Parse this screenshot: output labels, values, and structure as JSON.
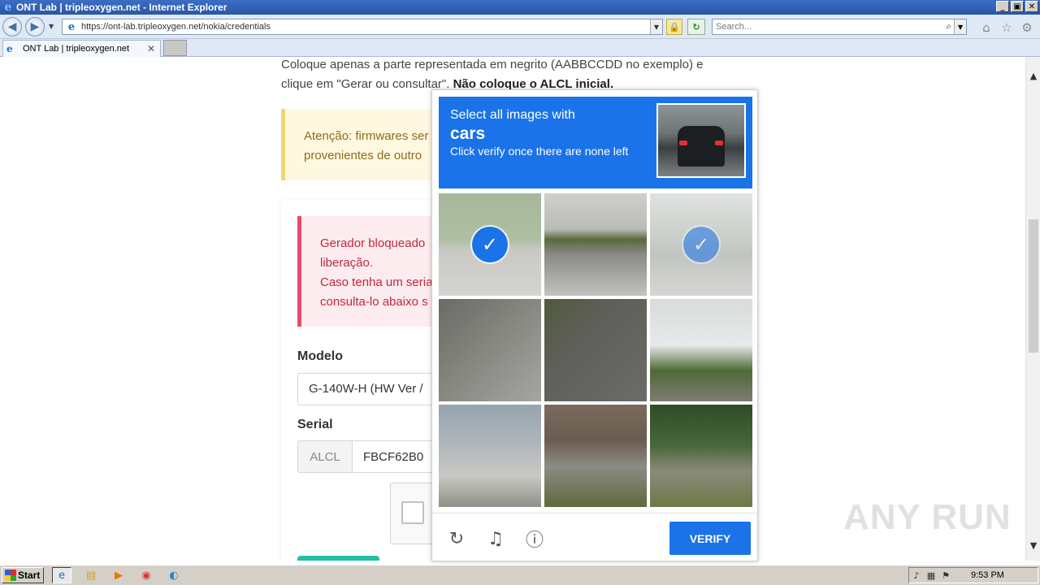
{
  "window": {
    "title": "ONT Lab | tripleoxygen.net - Internet Explorer",
    "controls": [
      "_",
      "▣",
      "✕"
    ]
  },
  "address": {
    "url": "https://ont-lab.tripleoxygen.net/nokia/credentials",
    "search_placeholder": "Search..."
  },
  "tabs": [
    {
      "label": "ONT Lab | tripleoxygen.net"
    }
  ],
  "page": {
    "instruction_line1": "Coloque apenas a parte representada em negrito (AABBCCDD no exemplo) e",
    "instruction_line2": "clique em \"Gerar ou consultar\". ",
    "instruction_bold": "Não coloque o ALCL inicial.",
    "warning_line1": "Atenção: firmwares ser",
    "warning_line2": "provenientes de outro",
    "alert_line1": "Gerador bloqueado",
    "alert_line2": "liberação.",
    "alert_line3": "Caso tenha um seria",
    "alert_line4": "consulta-lo abaixo s",
    "modelo_label": "Modelo",
    "modelo_value": "G-140W-H (HW Ver /",
    "serial_label": "Serial",
    "serial_prefix": "ALCL",
    "serial_value": "FBCF62B0"
  },
  "challenge": {
    "prompt_line1": "Select all images with",
    "target": "cars",
    "prompt_line3": "Click verify once there are none left",
    "verify_label": "VERIFY",
    "tiles": [
      {
        "name": "tile-street-car",
        "selected": true
      },
      {
        "name": "tile-road-overpass",
        "selected": false
      },
      {
        "name": "tile-street-car-2",
        "selected": true
      },
      {
        "name": "tile-crosswalk",
        "selected": false
      },
      {
        "name": "tile-road-line",
        "selected": false
      },
      {
        "name": "tile-traffic-light",
        "selected": false
      },
      {
        "name": "tile-bridge",
        "selected": false
      },
      {
        "name": "tile-bridge-cars",
        "selected": false
      },
      {
        "name": "tile-bridge-trees",
        "selected": false
      }
    ]
  },
  "watermark": "ANY RUN",
  "taskbar": {
    "start_label": "Start",
    "clock": "9:53 PM"
  },
  "colors": {
    "challenge_blue": "#1a73e8",
    "alert_red": "#c2273e",
    "warning_text": "#8a6d1d"
  }
}
